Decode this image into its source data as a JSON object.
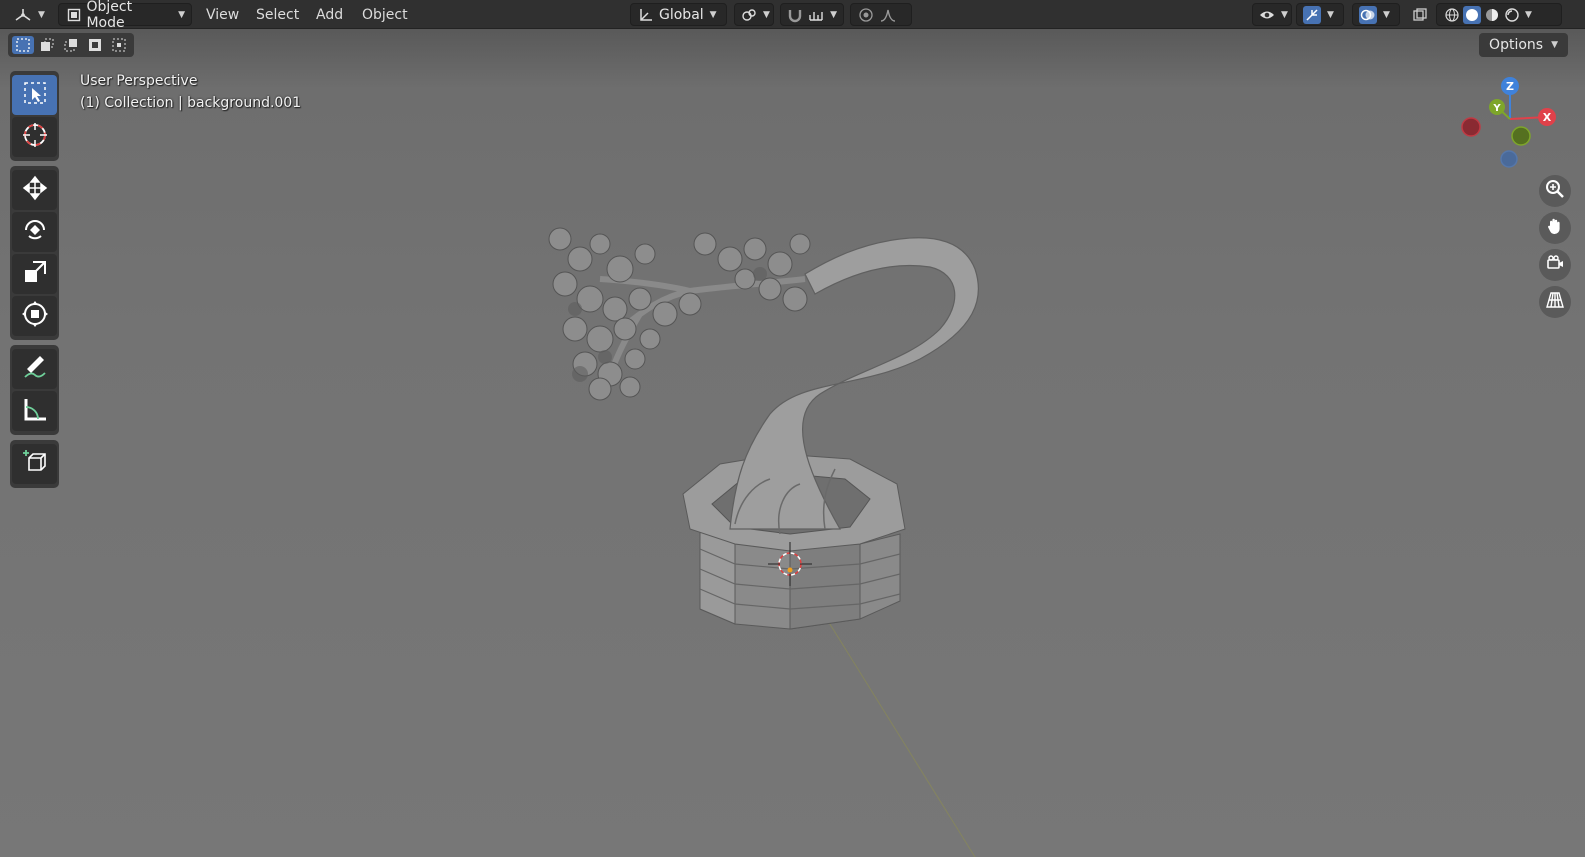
{
  "header": {
    "editor_type_icon": "3d-viewport-icon",
    "mode_label": "Object Mode",
    "menus": [
      "View",
      "Select",
      "Add",
      "Object"
    ],
    "orientation_label": "Global"
  },
  "viewport": {
    "perspective_label": "User Perspective",
    "collection_label": "(1) Collection | background.001",
    "options_label": "Options"
  },
  "gizmo": {
    "z_label": "Z",
    "y_label": "Y",
    "x_label": "X"
  },
  "colors": {
    "accent": "#4772b3",
    "axis_x": "#e0414a",
    "axis_y": "#7ea62a",
    "axis_z": "#3f82db"
  },
  "tools": [
    "select-box",
    "cursor",
    "move",
    "rotate",
    "scale",
    "transform",
    "annotate",
    "measure",
    "add-cube"
  ]
}
